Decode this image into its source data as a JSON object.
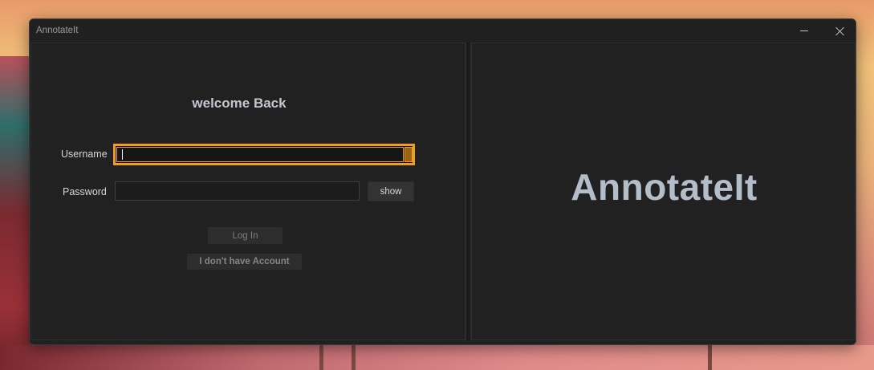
{
  "window": {
    "title": "AnnotateIt",
    "minimize_icon": "minimize-icon",
    "close_icon": "close-icon"
  },
  "login": {
    "heading": "welcome Back",
    "username_label": "Username",
    "username_value": "",
    "password_label": "Password",
    "password_value": "",
    "show_label": "show",
    "login_label": "Log In",
    "no_account_label": "I don't have Account"
  },
  "brand": {
    "title": "AnnotateIt"
  },
  "colors": {
    "focus_accent": "#f19e1e",
    "window_bg": "#202020",
    "brand_text": "#b3bec9",
    "heading_text": "#c2c7cf"
  }
}
